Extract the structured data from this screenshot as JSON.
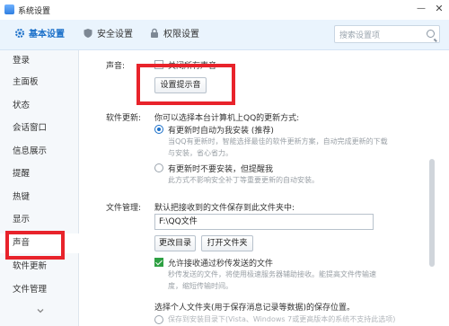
{
  "window": {
    "title": "系统设置",
    "minimize": "—",
    "close": "✕"
  },
  "top_tabs": [
    {
      "label": "基本设置",
      "icon": "gear-icon"
    },
    {
      "label": "安全设置",
      "icon": "shield-icon"
    },
    {
      "label": "权限设置",
      "icon": "lock-icon"
    }
  ],
  "search": {
    "placeholder": "搜索设置项"
  },
  "sidebar": {
    "items": [
      {
        "label": "登录"
      },
      {
        "label": "主面板"
      },
      {
        "label": "状态"
      },
      {
        "label": "会话窗口"
      },
      {
        "label": "信息展示"
      },
      {
        "label": "提醒"
      },
      {
        "label": "热键"
      },
      {
        "label": "显示"
      },
      {
        "label": "声音"
      },
      {
        "label": "软件更新"
      },
      {
        "label": "文件管理"
      }
    ],
    "active_index": 8
  },
  "sound": {
    "label": "声音:",
    "mute_all": "关闭所有声音",
    "mute_all_checked": false,
    "button": "设置提示音"
  },
  "update": {
    "label": "软件更新:",
    "intro": "你可以选择本台计算机上QQ的更新方式:",
    "option1": "有更新时自动为我安装 (推荐)",
    "option1_hint1": "当QQ有更新时，智能选择最佳的软件更新方案，自动完成更新的下载",
    "option1_hint2": "与安装，省心省力。",
    "option2": "有更新时不要安装，但提醒我",
    "option2_hint": "此方式不影响安全补丁等重要更新的自动安装。",
    "selected": 1
  },
  "files": {
    "label": "文件管理:",
    "intro": "默认把接收到的文件保存到此文件夹中:",
    "path": "F:\\QQ文件",
    "change_dir": "更改目录",
    "open_folder": "打开文件夹",
    "fast_receive": "允许接收通过秒传发送的文件",
    "fast_receive_checked": true,
    "fast_hint1": "秒传发送的文件，将使用极速服务器辅助接收。能提高文件传输速",
    "fast_hint2": "度，缩短传输时间。",
    "personal_intro": "选择个人文件夹(用于保存消息记录等数据)的保存位置。",
    "personal_option": "保存到安装目录下(Vista、Windows 7或更高版本的系统不支持此选项)"
  },
  "colors": {
    "accent": "#1a6fc9",
    "highlight": "#e8232b",
    "check_green": "#2ea043"
  }
}
